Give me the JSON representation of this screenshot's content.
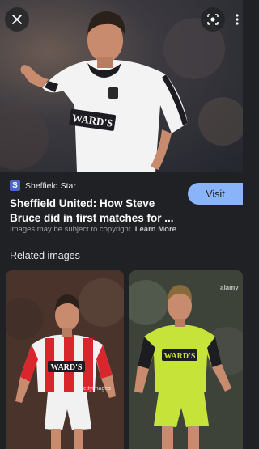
{
  "hero": {
    "image_alt": "Sheffield United player in white away kit",
    "shirt_sponsor": "WARD'S"
  },
  "toolbar": {
    "close_icon": "close-icon",
    "lens_icon": "lens-icon",
    "more_icon": "more-vert-icon"
  },
  "result": {
    "source_initial": "S",
    "source_name": "Sheffield Star",
    "title": "Sheffield United: How Steve Bruce did in first matches for ...",
    "visit_label": "Visit",
    "copyright_text": "Images may be subject to copyright.",
    "learn_more_label": "Learn More"
  },
  "related": {
    "heading": "Related images",
    "tiles": [
      {
        "alt": "Player in red and white striped kit",
        "shirt_sponsor": "WARD'S",
        "watermark": "gettyimages"
      },
      {
        "alt": "Player in lime green kit",
        "shirt_sponsor": "WARD'S",
        "watermark": "alamy"
      }
    ]
  },
  "colors": {
    "background": "#202124",
    "accent": "#8ab4f8",
    "favicon": "#4a64c8"
  }
}
